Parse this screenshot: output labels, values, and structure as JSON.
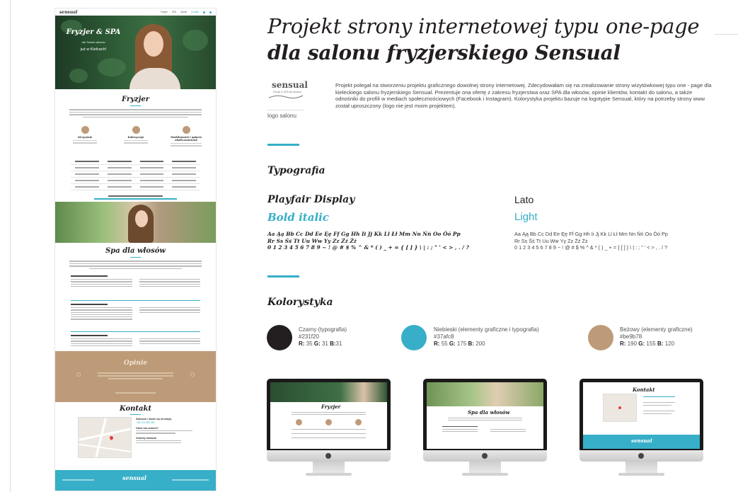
{
  "left_page": {
    "nav": {
      "logo": "sensual",
      "items": [
        "Fryzjer",
        "SPA",
        "Opinie",
        "Kontakt"
      ]
    },
    "hero": {
      "title": "Fryzjer & SPA",
      "tagline": "dla Twoich włosów",
      "location": "już w Kielcach!"
    },
    "sections": {
      "fryzjer": "Fryzjer",
      "spa": "Spa dla włosów",
      "opinie": "Opinie",
      "kontakt": "Kontakt"
    },
    "features": [
      "Strzyżenie",
      "Koloryzacja",
      "Modelowanie i upięcia okolicznościowe"
    ],
    "contact": {
      "call_label": "Zadzwoń i umów się na wizytę",
      "phone": "+48 123 456 789",
      "where_label": "Gdzie nas znaleźć?",
      "hours_label": "Godziny otwarcia"
    },
    "footer_logo": "sensual"
  },
  "header": {
    "title_line1": "Projekt strony internetowej typu one-page",
    "title_line2": "dla salonu fryzjerskiego Sensual"
  },
  "logo": {
    "wordmark": "sensual",
    "subtitle": "Fryzjer & SPA dla włosów",
    "caption": "logo salonu"
  },
  "description": "Projekt polegał na stworzeniu projektu graficznego dowolnej strony internetowej. Zdecydowałam się na zrealizowanie strony wizytówkowej typu one - page dla kieleckiego salonu fryzjerskiego Sensual. Prezentuje ona ofertę z zakresu fryzjerstwa oraz SPA dla włosów, opinie klientów, kontakt do salonu, a także odnośniki do profili w mediach społecznościowych (Facebook i Instagram). Kolorystyka projektu bazuje na logotypie Sensual, który na potrzeby strony www został uproszczony (logo nie jest moim projektem).",
  "typography": {
    "heading": "Typografia",
    "fonts": [
      {
        "name": "Playfair Display",
        "style": "Bold italic",
        "sample": "Aa Ąą Bb Cc Dd Ee Ęę Ff Gg Hh Ii Jj Kk Ll Łł Mm Nn Ńń Oo Óó Pp\nRr Ss Śś Tt Uu Ww Yy Zz Źź Żż\n0 1 2 3 4 5 6 7 8 9 ~ ! @ # $ % ^ & * ( ) _ + = { [ ] } \\ | : ; \" ' < > , . / ?"
      },
      {
        "name": "Lato",
        "style": "Light",
        "sample": "Aa Ąą Bb Cc Dd Ee Ęę Ff Gg Hh Ii Jj Kk Ll Łł Mm Nn Ńń Oo Óó Pp\nRr Ss Śś Tt Uu Ww Yy Zz Źź Żż\n0 1 2 3 4 5 6 7 8 9 ~ ! @ # $ % ^ & * ( ) _ + = { [ ] } \\ | : ; \" ' < > , . / ?"
      }
    ]
  },
  "colors": {
    "heading": "Kolorystyka",
    "items": [
      {
        "label": "Czarny (typografia)",
        "hex": "#231f20",
        "r": "35",
        "g": "31",
        "b": "31"
      },
      {
        "label": "Niebieski (elementy graficzne i typografia)",
        "hex": "#37afc8",
        "r": "55",
        "g": "175",
        "b": "200"
      },
      {
        "label": "Beżowy (elementy graficzne)",
        "hex": "#be9b78",
        "r": "190",
        "g": "155",
        "b": "120"
      }
    ]
  },
  "mockups": {
    "screens": [
      "Fryzjer",
      "Spa dla włosów",
      "Kontakt"
    ],
    "footer_logo": "sensual"
  }
}
